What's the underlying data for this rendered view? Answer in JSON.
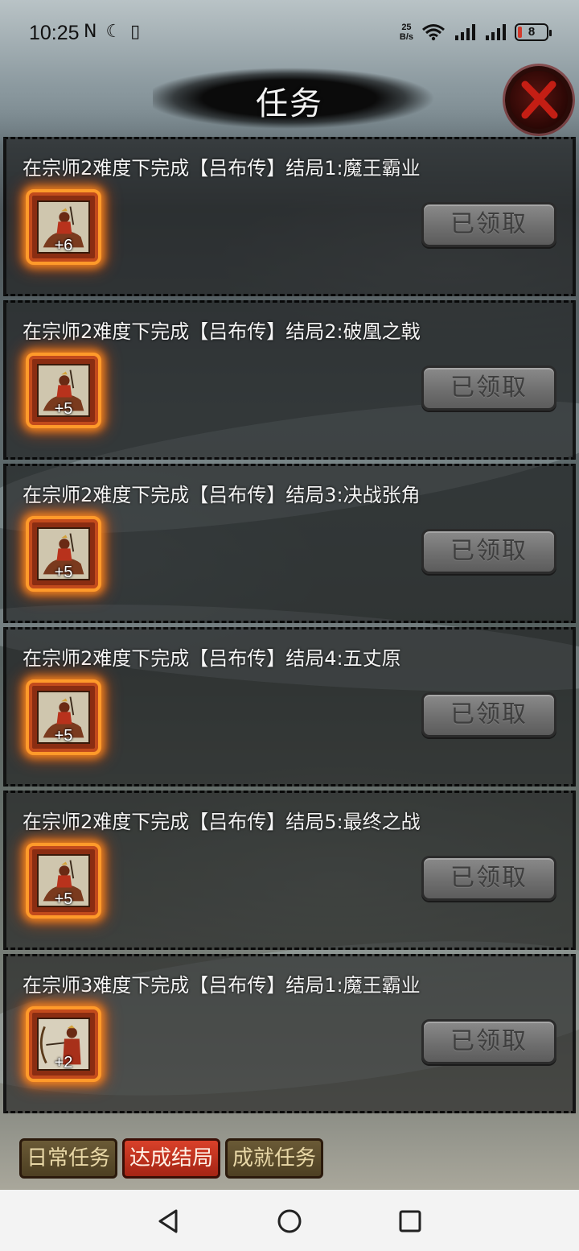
{
  "status_bar": {
    "time": "10:25",
    "left_icons": "N ☾ ▯",
    "net_speed_value": "25",
    "net_speed_unit": "B/s",
    "battery": "8"
  },
  "header": {
    "title": "任务"
  },
  "tasks": [
    {
      "desc": "在宗师2难度下完成【吕布传】结局1:魔王霸业",
      "reward": "+6",
      "button": "已领取",
      "icon": "cavalry-general-icon"
    },
    {
      "desc": "在宗师2难度下完成【吕布传】结局2:破凰之戟",
      "reward": "+5",
      "button": "已领取",
      "icon": "cavalry-general-icon"
    },
    {
      "desc": "在宗师2难度下完成【吕布传】结局3:决战张角",
      "reward": "+5",
      "button": "已领取",
      "icon": "cavalry-general-icon"
    },
    {
      "desc": "在宗师2难度下完成【吕布传】结局4:五丈原",
      "reward": "+5",
      "button": "已领取",
      "icon": "cavalry-general-icon"
    },
    {
      "desc": "在宗师2难度下完成【吕布传】结局5:最终之战",
      "reward": "+5",
      "button": "已领取",
      "icon": "cavalry-general-icon"
    },
    {
      "desc": "在宗师3难度下完成【吕布传】结局1:魔王霸业",
      "reward": "+2",
      "button": "已领取",
      "icon": "archer-icon"
    }
  ],
  "tabs": [
    {
      "label": "日常任务",
      "active": false
    },
    {
      "label": "达成结局",
      "active": true
    },
    {
      "label": "成就任务",
      "active": false
    }
  ],
  "colors": {
    "active_tab": "#d9412a",
    "reward_glow": "#ff9a2a",
    "claimed_button": "#6f6f6f"
  }
}
